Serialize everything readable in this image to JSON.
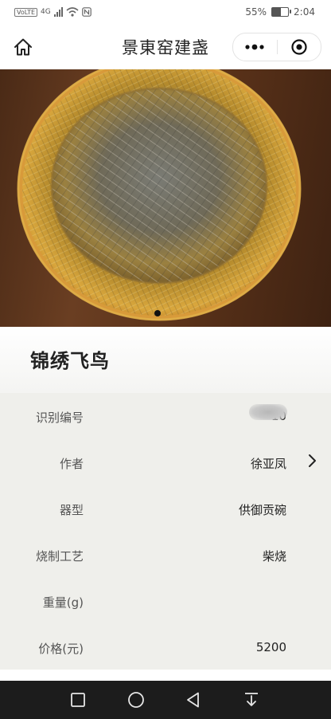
{
  "status_bar": {
    "network_badge": "VoLTE",
    "network_type": "4G",
    "battery_percent": "55%",
    "battery_level": 0.55,
    "time": "2:04"
  },
  "nav": {
    "title": "景東窑建盏"
  },
  "carousel": {
    "current_index": 1,
    "total": 1
  },
  "product": {
    "name": "锦绣飞鸟"
  },
  "details": [
    {
      "label": "识别编号",
      "value": "10",
      "redacted": true
    },
    {
      "label": "作者",
      "value": "徐亚凤",
      "has_arrow": true
    },
    {
      "label": "器型",
      "value": "供御贡碗"
    },
    {
      "label": "烧制工艺",
      "value": "柴烧"
    },
    {
      "label": "重量(g)",
      "value": ""
    },
    {
      "label": "价格(元)",
      "value": "5200"
    }
  ],
  "icons": {
    "home": "home-icon",
    "more": "more-dots-icon",
    "close": "mini-program-close-icon",
    "sys_recent": "square-icon",
    "sys_home": "circle-icon",
    "sys_back": "triangle-back-icon",
    "sys_notif": "pull-down-icon"
  }
}
